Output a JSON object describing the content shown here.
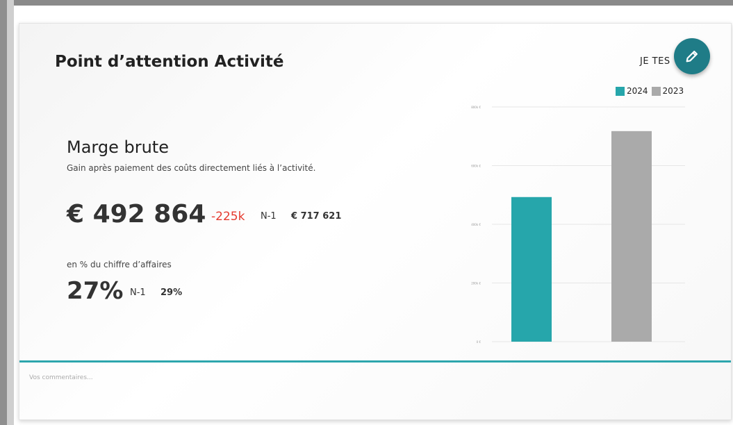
{
  "card": {
    "title": "Point d’attention Activité",
    "top_right_label": "JE TES"
  },
  "metric": {
    "name": "Marge brute",
    "description": "Gain après paiement des coûts directement liés à l’activité.",
    "value": "€ 492 864",
    "delta": "-225k",
    "n1_label": "N-1",
    "n1_value": "€ 717 621",
    "pct_label": "en % du chiffre d’affaires",
    "pct_value": "27%",
    "pct_n1_label": "N-1",
    "pct_n1_value": "29%"
  },
  "chart_data": {
    "type": "bar",
    "categories": [
      "2024",
      "2023"
    ],
    "values": [
      492864,
      717621
    ],
    "series": [
      {
        "name": "2024",
        "values": [
          492864
        ],
        "color": "#26a6ab"
      },
      {
        "name": "2023",
        "values": [
          717621
        ],
        "color": "#aaaaaa"
      }
    ],
    "ylim": [
      0,
      800000
    ],
    "ticks": [
      {
        "value": 0,
        "label": "0 €"
      },
      {
        "value": 200000,
        "label": "200k €"
      },
      {
        "value": 400000,
        "label": "400k €"
      },
      {
        "value": 600000,
        "label": "600k €"
      },
      {
        "value": 800000,
        "label": "800k €"
      }
    ],
    "legend": [
      {
        "label": "2024",
        "color": "#26a6ab"
      },
      {
        "label": "2023",
        "color": "#aaaaaa"
      }
    ],
    "legend_position": "top-right",
    "grid": true
  },
  "comments": {
    "placeholder": "Vos commentaires..."
  },
  "icons": {
    "edit": "pencil-icon"
  },
  "colors": {
    "accent": "#2da6ad",
    "edit_button": "#1f7c87",
    "delta_negative": "#e53a2f"
  }
}
